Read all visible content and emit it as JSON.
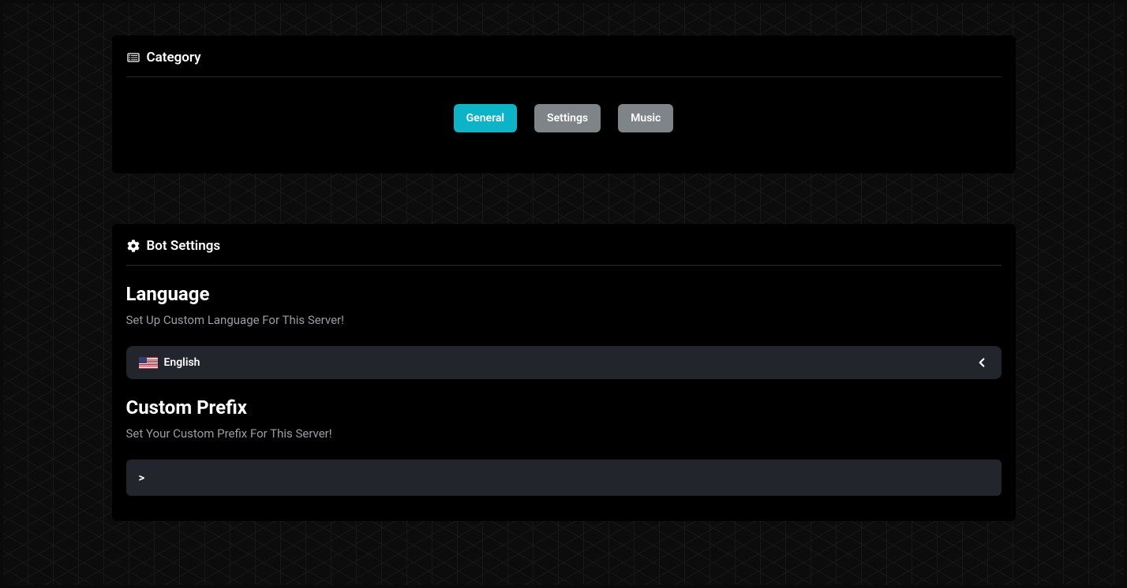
{
  "category": {
    "title": "Category",
    "tabs": [
      {
        "label": "General",
        "active": true
      },
      {
        "label": "Settings",
        "active": false
      },
      {
        "label": "Music",
        "active": false
      }
    ]
  },
  "settings": {
    "title": "Bot Settings",
    "language": {
      "heading": "Language",
      "description": "Set Up Custom Language For This Server!",
      "selected": "English"
    },
    "prefix": {
      "heading": "Custom Prefix",
      "description": "Set Your Custom Prefix For This Server!",
      "value": ">"
    }
  }
}
